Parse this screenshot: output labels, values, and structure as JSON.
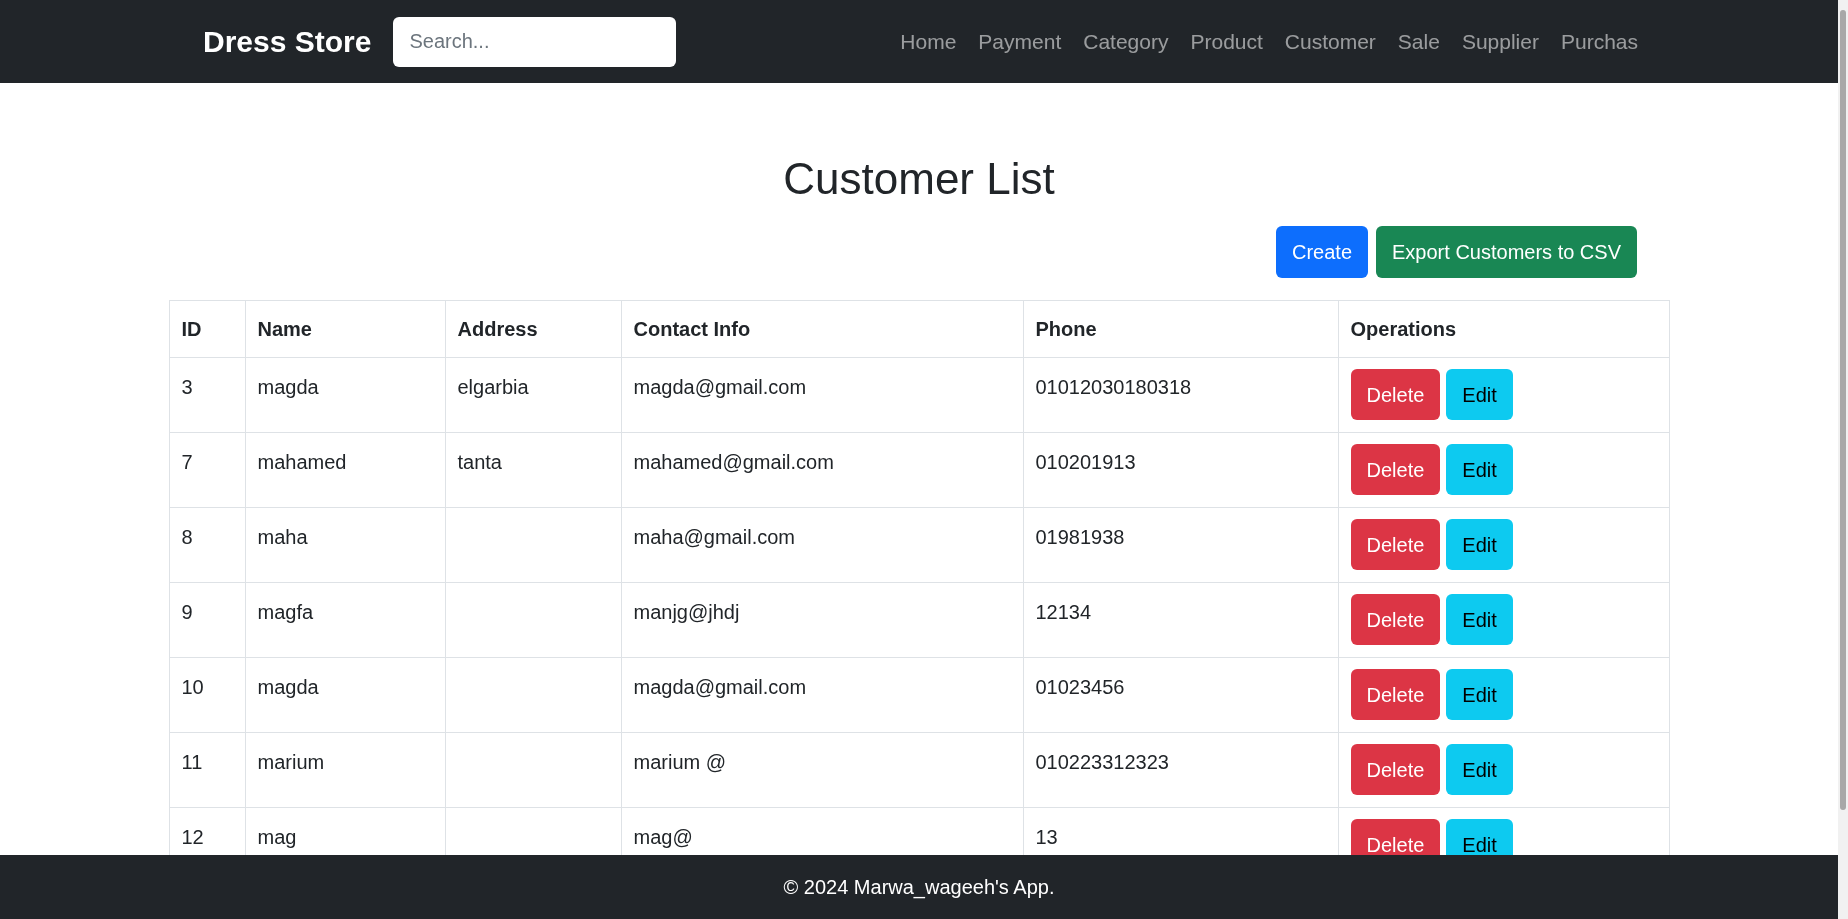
{
  "navbar": {
    "brand": "Dress Store",
    "search": {
      "placeholder": "Search..."
    },
    "links": [
      "Home",
      "Payment",
      "Category",
      "Product",
      "Customer",
      "Sale",
      "Supplier",
      "Purchas"
    ]
  },
  "page": {
    "title": "Customer List",
    "actions": [
      {
        "label": "Create",
        "kind": "primary"
      },
      {
        "label": "Export Customers to CSV",
        "kind": "success"
      }
    ]
  },
  "table": {
    "columns": [
      "ID",
      "Name",
      "Address",
      "Contact Info",
      "Phone",
      "Operations"
    ],
    "rows": [
      {
        "id": "3",
        "name": "magda",
        "address": "elgarbia",
        "contact": "magda@gmail.com",
        "phone": "01012030180318",
        "actions": [
          "Delete",
          "Edit"
        ]
      },
      {
        "id": "7",
        "name": "mahamed",
        "address": "tanta",
        "contact": "mahamed@gmail.com",
        "phone": "010201913",
        "actions": [
          "Delete",
          "Edit"
        ]
      },
      {
        "id": "8",
        "name": "maha",
        "address": "",
        "contact": "maha@gmail.com",
        "phone": "01981938",
        "actions": [
          "Delete",
          "Edit"
        ]
      },
      {
        "id": "9",
        "name": "magfa",
        "address": "",
        "contact": "manjg@jhdj",
        "phone": "12134",
        "actions": [
          "Delete",
          "Edit"
        ]
      },
      {
        "id": "10",
        "name": "magda",
        "address": "",
        "contact": "magda@gmail.com",
        "phone": "01023456",
        "actions": [
          "Delete",
          "Edit"
        ]
      },
      {
        "id": "11",
        "name": "marium",
        "address": "",
        "contact": "marium @",
        "phone": "010223312323",
        "actions": [
          "Delete",
          "Edit"
        ]
      },
      {
        "id": "12",
        "name": "mag",
        "address": "",
        "contact": "mag@",
        "phone": "13",
        "actions": [
          "Delete",
          "Edit"
        ]
      }
    ]
  },
  "footer": {
    "text": "© 2024 Marwa_wageeh's App."
  }
}
